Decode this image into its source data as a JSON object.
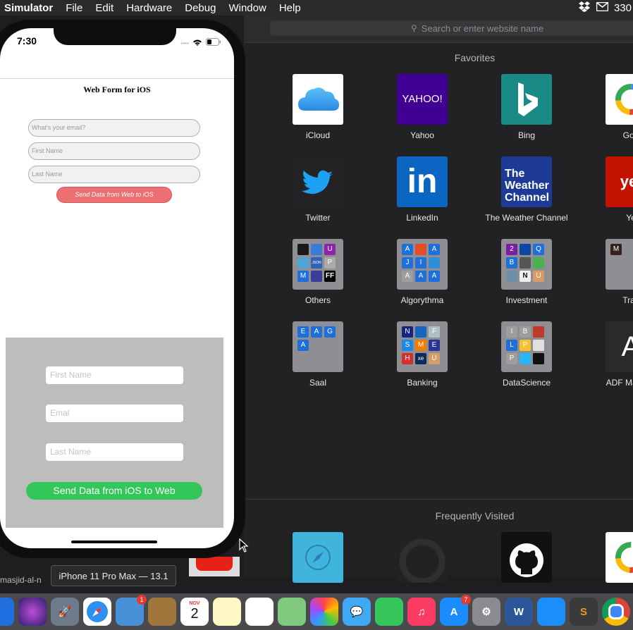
{
  "menubar": {
    "app": "Simulator",
    "items": [
      "File",
      "Edit",
      "Hardware",
      "Debug",
      "Window",
      "Help"
    ],
    "right_text": "330"
  },
  "safari": {
    "search_placeholder": "Search or enter website name",
    "favorites_title": "Favorites",
    "favorites": [
      {
        "label": "iCloud"
      },
      {
        "label": "Yahoo",
        "icon_text": "YAHOO!"
      },
      {
        "label": "Bing"
      },
      {
        "label": "Goo"
      },
      {
        "label": "Twitter"
      },
      {
        "label": "LinkedIn",
        "icon_text": "in"
      },
      {
        "label": "The Weather Channel",
        "icon_text": "The Weather Channel"
      },
      {
        "label": "Ye",
        "icon_text": "yel"
      },
      {
        "label": "Others",
        "folder": [
          "",
          "",
          "U",
          "",
          "JSON",
          "P",
          "M",
          "",
          "FF"
        ]
      },
      {
        "label": "Algorythma",
        "folder": [
          "A",
          "",
          "A",
          "J",
          "I",
          "",
          "A",
          "A",
          "A"
        ]
      },
      {
        "label": "Investment",
        "folder": [
          "2",
          "",
          "Q",
          "B",
          "",
          "",
          "",
          "N",
          "U"
        ]
      },
      {
        "label": "Trav",
        "folder": [
          "M"
        ]
      },
      {
        "label": "Saal",
        "folder": [
          "E",
          "A",
          "G",
          "A"
        ]
      },
      {
        "label": "Banking",
        "folder": [
          "N",
          "",
          "F",
          "S",
          "M",
          "E",
          "H",
          "xe",
          "U"
        ]
      },
      {
        "label": "DataScience",
        "folder": [
          "I",
          "B",
          "",
          "L",
          "P",
          "",
          "P",
          "",
          ""
        ]
      },
      {
        "label": "ADF Manage",
        "icon_text": "A"
      }
    ],
    "frequent_title": "Frequently Visited"
  },
  "phone": {
    "time": "7:30",
    "web_title": "Web Form for iOS",
    "web_email_placeholder": "What's your email?",
    "web_first_placeholder": "First Name",
    "web_last_placeholder": "Last Name",
    "web_button": "Send Data from Web to iOS",
    "native_first_placeholder": "First Name",
    "native_email_placeholder": "Emal",
    "native_last_placeholder": "Last Name",
    "native_button": "Send Data from  iOS to Web"
  },
  "tooltip": "iPhone 11 Pro Max — 13.1",
  "left_crop_text": "masjid-al-n",
  "dock": {
    "calendar_month": "NOV",
    "calendar_day": "2",
    "mail_badge": "1",
    "appstore_badge": "7"
  }
}
